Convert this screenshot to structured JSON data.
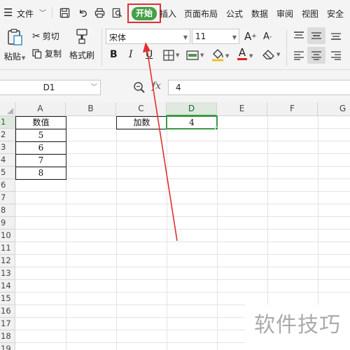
{
  "menubar": {
    "file_label": "文件",
    "tabs": [
      "开始",
      "插入",
      "页面布局",
      "公式",
      "数据",
      "审阅",
      "视图",
      "安全"
    ]
  },
  "ribbon": {
    "paste_label": "粘贴",
    "cut_label": "剪切",
    "copy_label": "复制",
    "format_painter_label": "格式刷",
    "font_name": "宋体",
    "font_size": "11",
    "bold": "B",
    "italic": "I",
    "underline": "U"
  },
  "formula_bar": {
    "cell_ref": "D1",
    "fx_label": "fx",
    "value": "4"
  },
  "sheet": {
    "columns": [
      "A",
      "B",
      "C",
      "D",
      "E",
      "F",
      "G"
    ],
    "rows": [
      "1",
      "2",
      "3",
      "4",
      "5",
      "6",
      "7",
      "8",
      "9",
      "10",
      "11",
      "12",
      "13",
      "14",
      "15",
      "16",
      "17",
      "18",
      "19"
    ],
    "cells": {
      "A1": "数值",
      "A2": "5",
      "A3": "6",
      "A4": "7",
      "A5": "8",
      "C1": "加数",
      "D1": "4"
    },
    "selected_cell": "D1"
  },
  "watermark": "软件技巧",
  "colors": {
    "accent_green": "#3a9a45",
    "home_tab_bg": "#45a047",
    "highlight_red": "#e03030"
  }
}
